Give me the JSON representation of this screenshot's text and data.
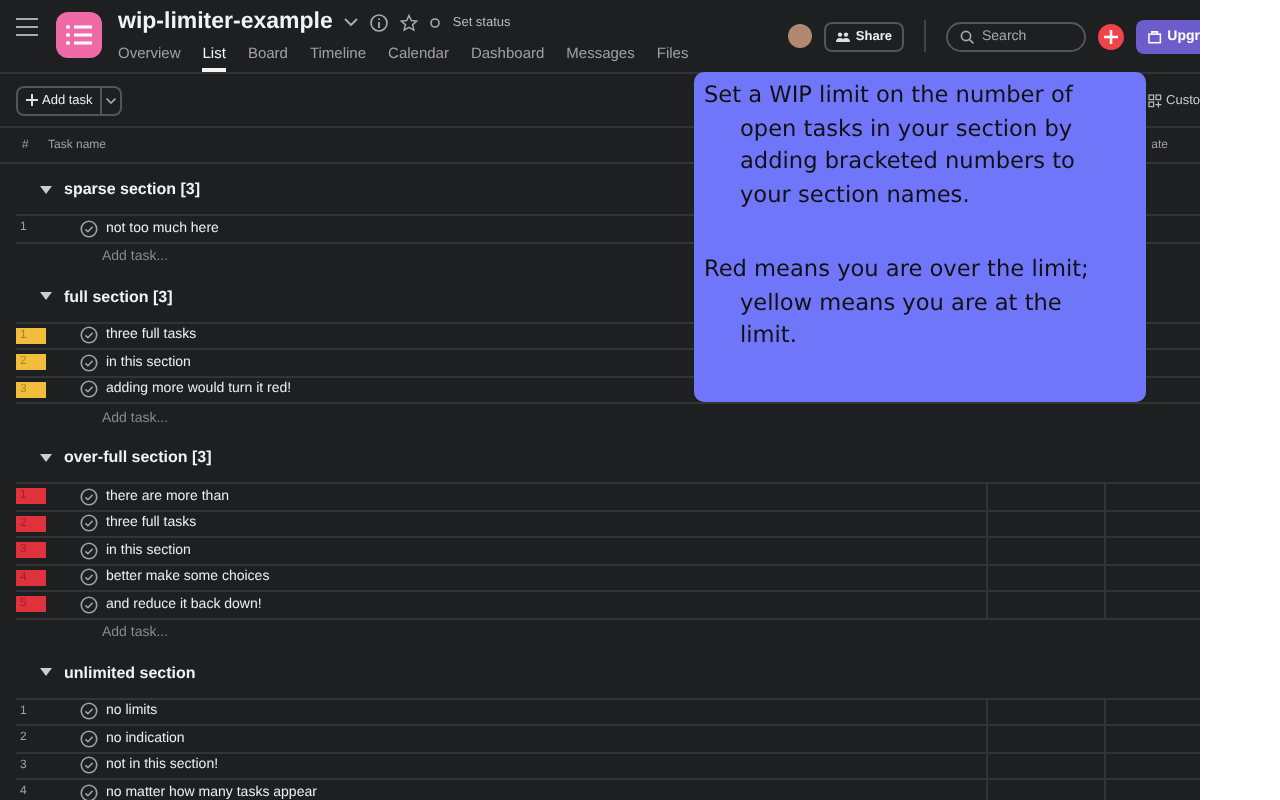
{
  "header": {
    "title": "wip-limiter-example",
    "status": "Set status",
    "share": "Share",
    "search_placeholder": "Search",
    "upgrade": "Upgr",
    "tabs": [
      {
        "label": "Overview",
        "selected": false
      },
      {
        "label": "List",
        "selected": true
      },
      {
        "label": "Board",
        "selected": false
      },
      {
        "label": "Timeline",
        "selected": false
      },
      {
        "label": "Calendar",
        "selected": false
      },
      {
        "label": "Dashboard",
        "selected": false
      },
      {
        "label": "Messages",
        "selected": false
      },
      {
        "label": "Files",
        "selected": false
      }
    ]
  },
  "toolbar": {
    "add_task": "Add task",
    "customize": "Custo"
  },
  "columns": {
    "number": "#",
    "task_name": "Task name",
    "column_3": "ate"
  },
  "sections": [
    {
      "name": "sparse section [3]",
      "add_task": "Add task...",
      "tasks": [
        {
          "number": "1",
          "name": "not too much here"
        }
      ]
    },
    {
      "name": "full section [3]",
      "color": "#f1bd3c",
      "add_task": "Add task...",
      "tasks": [
        {
          "number": "1",
          "name": "three full tasks"
        },
        {
          "number": "2",
          "name": "in this section"
        },
        {
          "number": "3",
          "name": "adding more would turn it red!"
        }
      ]
    },
    {
      "name": "over-full section [3]",
      "color": "#e0323c",
      "add_task": "Add task...",
      "tasks": [
        {
          "number": "1",
          "name": "there are more than"
        },
        {
          "number": "2",
          "name": "three full tasks"
        },
        {
          "number": "3",
          "name": "in this section"
        },
        {
          "number": "4",
          "name": "better make some choices"
        },
        {
          "number": "5",
          "name": "and reduce it back down!"
        }
      ]
    },
    {
      "name": "unlimited section",
      "tasks": [
        {
          "number": "1",
          "name": "no limits"
        },
        {
          "number": "2",
          "name": "no indication"
        },
        {
          "number": "3",
          "name": "not in this section!"
        },
        {
          "number": "4",
          "name": "no matter how many tasks appear"
        }
      ]
    }
  ],
  "tooltip": {
    "paragraphs": [
      "Set a WIP limit on the number of open tasks in your section by adding bracketed numbers to your section names.",
      "Red means you are over the limit; yellow means you are at the limit."
    ]
  }
}
